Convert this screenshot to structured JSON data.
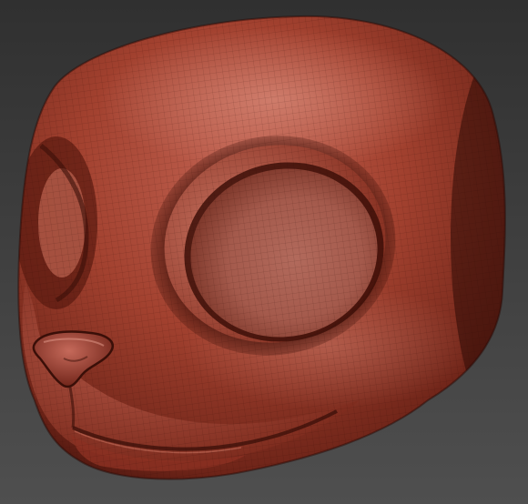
{
  "scene": {
    "subject": "",
    "background_top": "#303030",
    "background_bottom": "#4f4f4f",
    "material_base": "#9a3e2e",
    "material_light": "#c96a57",
    "material_shadow": "#4a150d",
    "material_deep": "#2c0a06",
    "wireframe": true
  }
}
